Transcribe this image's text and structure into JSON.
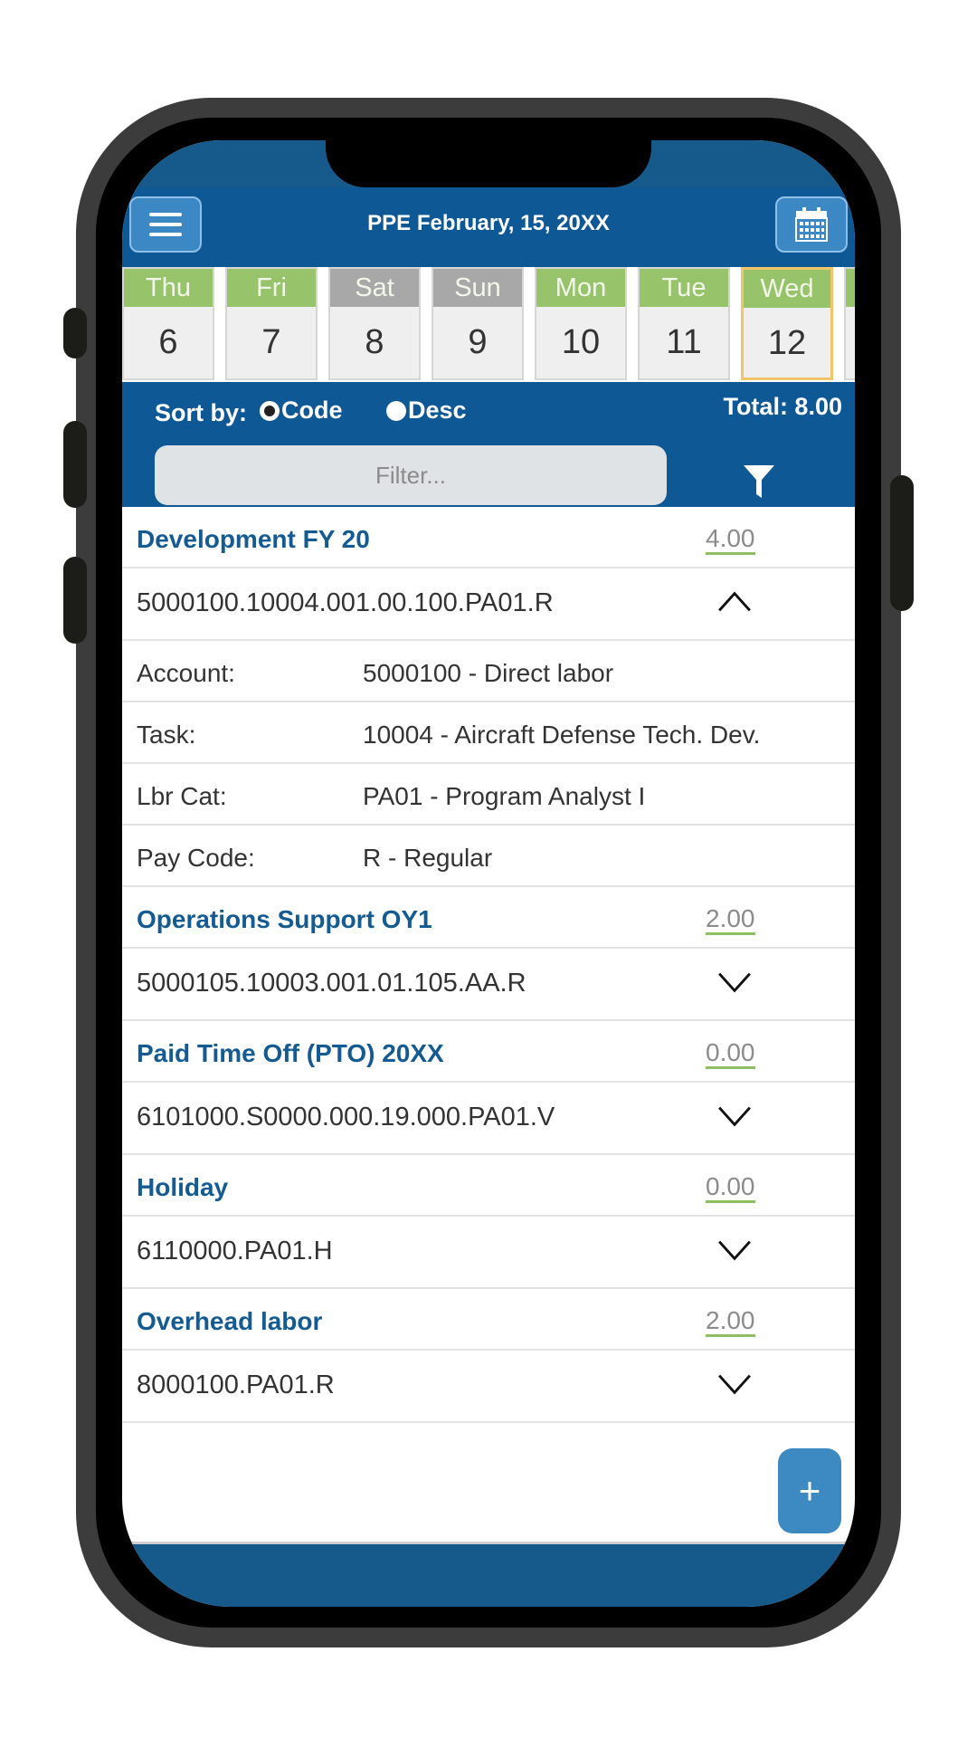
{
  "header": {
    "title": "PPE February, 15, 20XX",
    "menu_icon": "hamburger-menu-icon",
    "calendar_icon": "calendar-icon"
  },
  "days": [
    {
      "name": "Thu",
      "num": "6",
      "type": "weekday",
      "selected": false
    },
    {
      "name": "Fri",
      "num": "7",
      "type": "weekday",
      "selected": false
    },
    {
      "name": "Sat",
      "num": "8",
      "type": "weekend",
      "selected": false
    },
    {
      "name": "Sun",
      "num": "9",
      "type": "weekend",
      "selected": false
    },
    {
      "name": "Mon",
      "num": "10",
      "type": "weekday",
      "selected": false
    },
    {
      "name": "Tue",
      "num": "11",
      "type": "weekday",
      "selected": false
    },
    {
      "name": "Wed",
      "num": "12",
      "type": "weekday",
      "selected": true
    }
  ],
  "sort": {
    "label": "Sort by:",
    "options": [
      {
        "label": "Code",
        "checked": true
      },
      {
        "label": "Desc",
        "checked": false
      }
    ],
    "total": "Total: 8.00"
  },
  "filter": {
    "placeholder": "Filter...",
    "icon": "filter-funnel-icon"
  },
  "entries": [
    {
      "title": "Development FY 20",
      "hours": "4.00",
      "code": "5000100.10004.001.00.100.PA01.R",
      "expanded": true,
      "details": [
        {
          "label": "Account:",
          "value": "5000100 - Direct labor"
        },
        {
          "label": "Task:",
          "value": "10004 - Aircraft Defense Tech. Dev."
        },
        {
          "label": "Lbr Cat:",
          "value": "PA01 - Program Analyst I"
        },
        {
          "label": "Pay Code:",
          "value": "R - Regular"
        }
      ]
    },
    {
      "title": "Operations Support OY1",
      "hours": "2.00",
      "code": "5000105.10003.001.01.105.AA.R",
      "expanded": false
    },
    {
      "title": "Paid Time Off (PTO) 20XX",
      "hours": "0.00",
      "code": "6101000.S0000.000.19.000.PA01.V",
      "expanded": false
    },
    {
      "title": "Holiday",
      "hours": "0.00",
      "code": "6110000.PA01.H",
      "expanded": false
    },
    {
      "title": "Overhead labor",
      "hours": "2.00",
      "code": "8000100.PA01.R",
      "expanded": false
    }
  ],
  "add_button": {
    "label": "+"
  },
  "colors": {
    "primary": "#0f5896",
    "weekday": "#97c36b",
    "weekend": "#a8a8a8",
    "selected_day_border": "#f3c56a",
    "hours_underline": "#8cc063"
  }
}
